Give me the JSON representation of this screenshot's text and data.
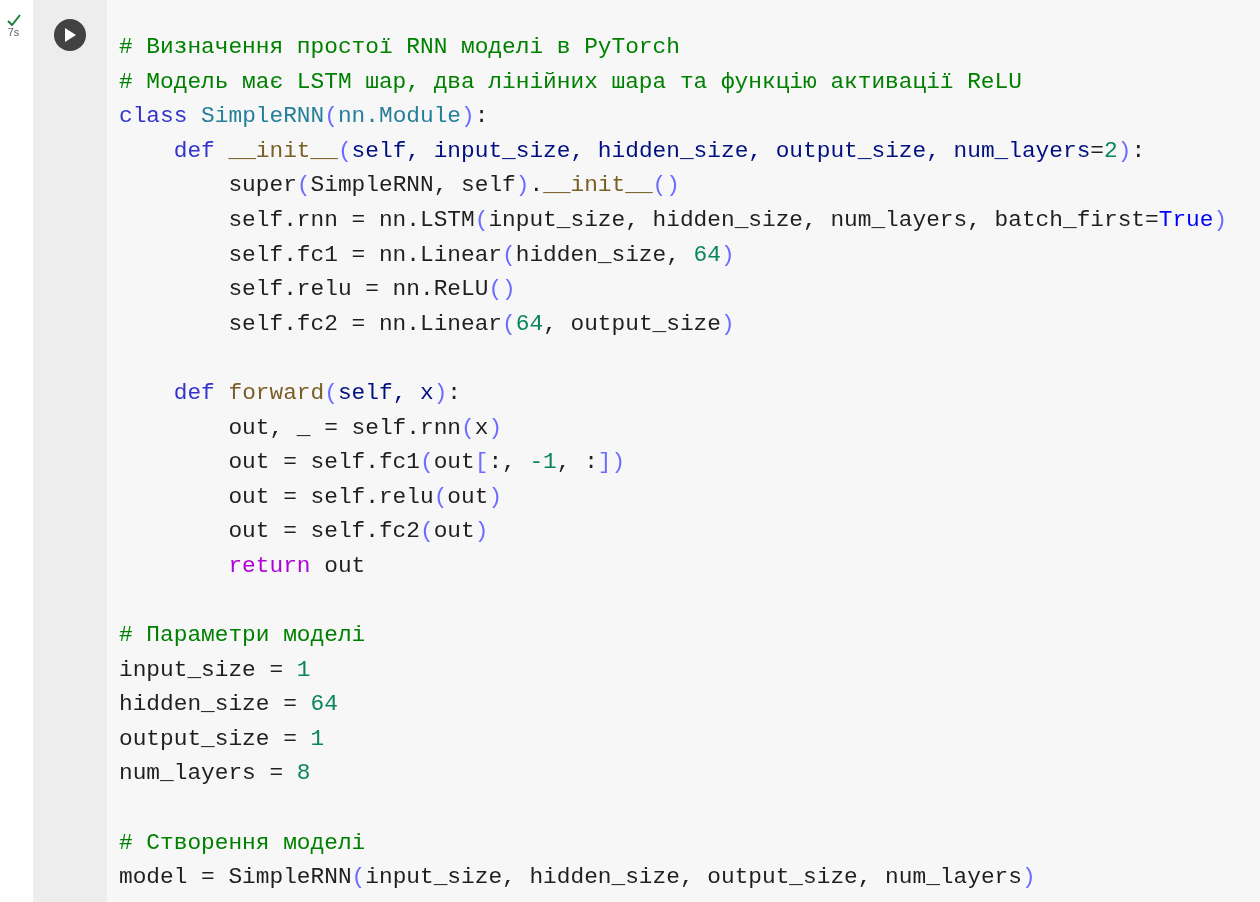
{
  "cell": {
    "succeeded": true,
    "duration": "7s",
    "blocks": [
      {
        "lines": [
          {
            "tokens": [
              {
                "kind": "comment",
                "t": "# Визначення простої RNN моделі в PyTorch"
              }
            ]
          },
          {
            "tokens": [
              {
                "kind": "comment",
                "t": "# Модель має LSTM шар, два лінійних шара та функцію активації ReLU"
              }
            ]
          },
          {
            "tokens": [
              {
                "kind": "keyword",
                "t": "class "
              },
              {
                "kind": "class",
                "t": "SimpleRNN"
              },
              {
                "kind": "bracket",
                "t": "("
              },
              {
                "kind": "class",
                "t": "nn.Module"
              },
              {
                "kind": "bracket",
                "t": ")"
              },
              {
                "kind": "plain",
                "t": ":"
              }
            ]
          },
          {
            "tokens": [
              {
                "kind": "keyword",
                "t": "    def "
              },
              {
                "kind": "function",
                "t": "__init__"
              },
              {
                "kind": "bracket",
                "t": "("
              },
              {
                "kind": "param",
                "t": "self, input_size, hidden_size, output_size, num_layers"
              },
              {
                "kind": "plain",
                "t": "="
              },
              {
                "kind": "number",
                "t": "2"
              },
              {
                "kind": "bracket",
                "t": ")"
              },
              {
                "kind": "plain",
                "t": ":"
              }
            ]
          },
          {
            "tokens": [
              {
                "kind": "plain",
                "t": "        super"
              },
              {
                "kind": "bracket",
                "t": "("
              },
              {
                "kind": "plain",
                "t": "SimpleRNN, self"
              },
              {
                "kind": "bracket",
                "t": ")"
              },
              {
                "kind": "plain",
                "t": "."
              },
              {
                "kind": "function",
                "t": "__init__"
              },
              {
                "kind": "bracket",
                "t": "()"
              }
            ]
          },
          {
            "tokens": [
              {
                "kind": "plain",
                "t": "        self.rnn = nn.LSTM"
              },
              {
                "kind": "bracket",
                "t": "("
              },
              {
                "kind": "plain",
                "t": "input_size, hidden_size, num_layers, batch_first="
              },
              {
                "kind": "constant",
                "t": "True"
              },
              {
                "kind": "bracket",
                "t": ")"
              }
            ]
          },
          {
            "tokens": [
              {
                "kind": "plain",
                "t": "        self.fc1 = nn.Linear"
              },
              {
                "kind": "bracket",
                "t": "("
              },
              {
                "kind": "plain",
                "t": "hidden_size, "
              },
              {
                "kind": "number",
                "t": "64"
              },
              {
                "kind": "bracket",
                "t": ")"
              }
            ]
          },
          {
            "tokens": [
              {
                "kind": "plain",
                "t": "        self.relu = nn.ReLU"
              },
              {
                "kind": "bracket",
                "t": "()"
              }
            ]
          },
          {
            "tokens": [
              {
                "kind": "plain",
                "t": "        self.fc2 = nn.Linear"
              },
              {
                "kind": "bracket",
                "t": "("
              },
              {
                "kind": "number",
                "t": "64"
              },
              {
                "kind": "plain",
                "t": ", output_size"
              },
              {
                "kind": "bracket",
                "t": ")"
              }
            ]
          }
        ]
      },
      {
        "lines": [
          {
            "tokens": [
              {
                "kind": "keyword",
                "t": "    def "
              },
              {
                "kind": "function",
                "t": "forward"
              },
              {
                "kind": "bracket",
                "t": "("
              },
              {
                "kind": "param",
                "t": "self, x"
              },
              {
                "kind": "bracket",
                "t": ")"
              },
              {
                "kind": "plain",
                "t": ":"
              }
            ]
          },
          {
            "tokens": [
              {
                "kind": "plain",
                "t": "        out, _ = self.rnn"
              },
              {
                "kind": "bracket",
                "t": "("
              },
              {
                "kind": "plain",
                "t": "x"
              },
              {
                "kind": "bracket",
                "t": ")"
              }
            ]
          },
          {
            "tokens": [
              {
                "kind": "plain",
                "t": "        out = self.fc1"
              },
              {
                "kind": "bracket",
                "t": "("
              },
              {
                "kind": "plain",
                "t": "out"
              },
              {
                "kind": "bracket",
                "t": "["
              },
              {
                "kind": "plain",
                "t": ":, "
              },
              {
                "kind": "number",
                "t": "-1"
              },
              {
                "kind": "plain",
                "t": ", :"
              },
              {
                "kind": "bracket",
                "t": "])"
              }
            ]
          },
          {
            "tokens": [
              {
                "kind": "plain",
                "t": "        out = self.relu"
              },
              {
                "kind": "bracket",
                "t": "("
              },
              {
                "kind": "plain",
                "t": "out"
              },
              {
                "kind": "bracket",
                "t": ")"
              }
            ]
          },
          {
            "tokens": [
              {
                "kind": "plain",
                "t": "        out = self.fc2"
              },
              {
                "kind": "bracket",
                "t": "("
              },
              {
                "kind": "plain",
                "t": "out"
              },
              {
                "kind": "bracket",
                "t": ")"
              }
            ]
          },
          {
            "tokens": [
              {
                "kind": "control",
                "t": "        return"
              },
              {
                "kind": "plain",
                "t": " out"
              }
            ]
          }
        ]
      },
      {
        "lines": [
          {
            "tokens": [
              {
                "kind": "comment",
                "t": "# Параметри моделі"
              }
            ]
          },
          {
            "tokens": [
              {
                "kind": "plain",
                "t": "input_size = "
              },
              {
                "kind": "number",
                "t": "1"
              }
            ]
          },
          {
            "tokens": [
              {
                "kind": "plain",
                "t": "hidden_size = "
              },
              {
                "kind": "number",
                "t": "64"
              }
            ]
          },
          {
            "tokens": [
              {
                "kind": "plain",
                "t": "output_size = "
              },
              {
                "kind": "number",
                "t": "1"
              }
            ]
          },
          {
            "tokens": [
              {
                "kind": "plain",
                "t": "num_layers = "
              },
              {
                "kind": "number",
                "t": "8"
              }
            ]
          }
        ]
      },
      {
        "lines": [
          {
            "tokens": [
              {
                "kind": "comment",
                "t": "# Створення моделі"
              }
            ]
          },
          {
            "tokens": [
              {
                "kind": "plain",
                "t": "model = SimpleRNN"
              },
              {
                "kind": "bracket",
                "t": "("
              },
              {
                "kind": "plain",
                "t": "input_size, hidden_size, output_size, num_layers"
              },
              {
                "kind": "bracket",
                "t": ")"
              }
            ]
          }
        ]
      }
    ]
  }
}
